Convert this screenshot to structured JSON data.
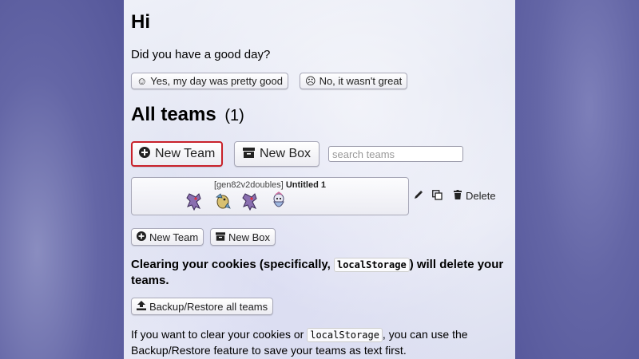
{
  "greeting": {
    "title": "Hi",
    "question": "Did you have a good day?",
    "yes_icon": "☺",
    "yes_label": "Yes, my day was pretty good",
    "no_icon": "☹",
    "no_label": "No, it wasn't great"
  },
  "teams": {
    "heading": "All teams",
    "count": "(1)",
    "new_team_label": "New Team",
    "new_box_label": "New Box",
    "search_placeholder": "search teams",
    "list": [
      {
        "format": "[gen82v2doubles]",
        "name": "Untitled 1",
        "sprites": [
          "genesect-sprite",
          "bird-mon-sprite",
          "genesect-sprite",
          "fairy-mon-sprite"
        ]
      }
    ],
    "delete_label": "Delete"
  },
  "bottom": {
    "new_team_label": "New Team",
    "new_box_label": "New Box",
    "warning_pre": "Clearing your cookies (specifically, ",
    "warning_code": "localStorage",
    "warning_post": ") will delete your teams.",
    "backup_label": "Backup/Restore all teams",
    "info_pre": "If you want to clear your cookies or ",
    "info_code": "localStorage",
    "info_post": ", you can use the Backup/Restore feature to save your teams as text first."
  },
  "colors": {
    "highlight_border": "#c8212a",
    "background": "#6466a6"
  }
}
